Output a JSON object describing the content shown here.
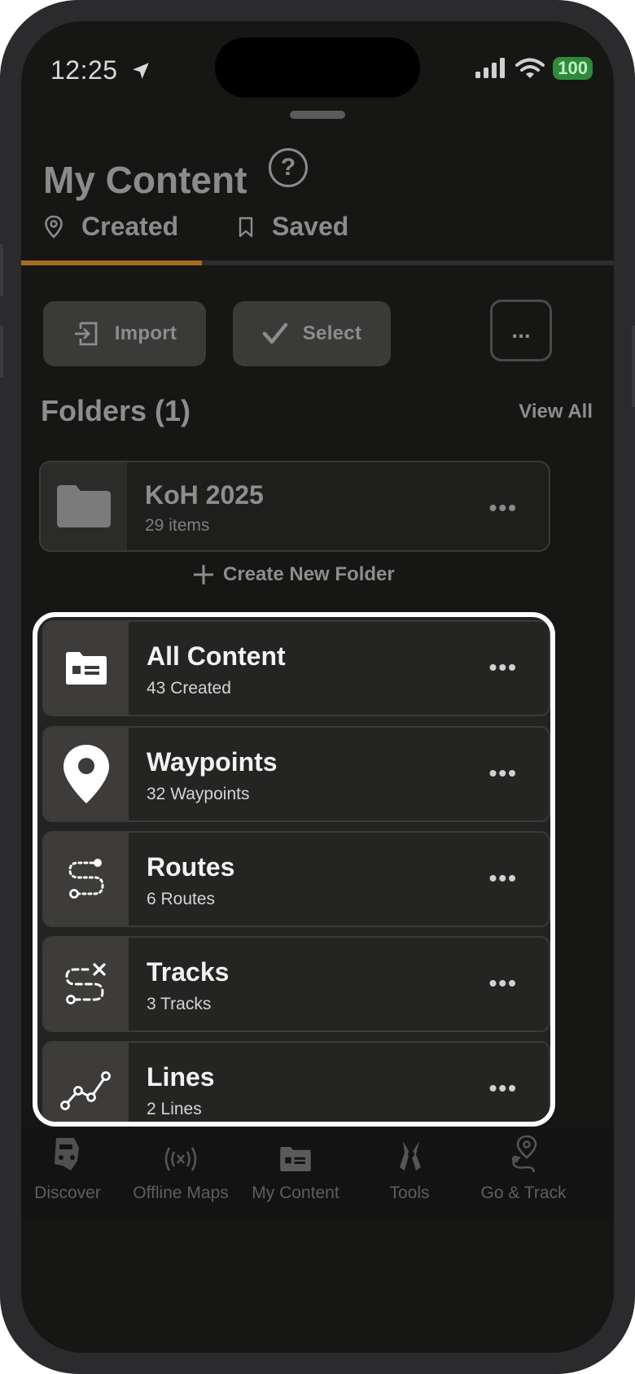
{
  "status_bar": {
    "time": "12:25",
    "battery": "100"
  },
  "header": {
    "title": "My Content"
  },
  "tabs": [
    {
      "label": "Created",
      "active": true
    },
    {
      "label": "Saved",
      "active": false
    }
  ],
  "toolbar": {
    "import_label": "Import",
    "select_label": "Select",
    "more_label": "..."
  },
  "folders": {
    "title": "Folders (1)",
    "view_all": "View All",
    "items": [
      {
        "name": "KoH 2025",
        "count": "29 items"
      }
    ],
    "create_label": "Create New Folder"
  },
  "content_items": [
    {
      "title": "All Content",
      "subtitle": "43 Created",
      "icon": "content-card-icon"
    },
    {
      "title": "Waypoints",
      "subtitle": "32 Waypoints",
      "icon": "map-pin-icon"
    },
    {
      "title": "Routes",
      "subtitle": "6 Routes",
      "icon": "route-icon"
    },
    {
      "title": "Tracks",
      "subtitle": "3 Tracks",
      "icon": "track-icon"
    },
    {
      "title": "Lines",
      "subtitle": "2 Lines",
      "icon": "line-icon"
    }
  ],
  "bottom_nav": [
    {
      "label": "Discover",
      "icon": "jeep-icon"
    },
    {
      "label": "Offline Maps",
      "icon": "offline-signal-icon"
    },
    {
      "label": "My Content",
      "icon": "content-card-icon"
    },
    {
      "label": "Tools",
      "icon": "tools-icon"
    },
    {
      "label": "Go & Track",
      "icon": "go-track-icon"
    }
  ],
  "colors": {
    "accent": "#a46d1e",
    "highlight_border": "#ffffff",
    "battery": "#2f8a3b"
  }
}
